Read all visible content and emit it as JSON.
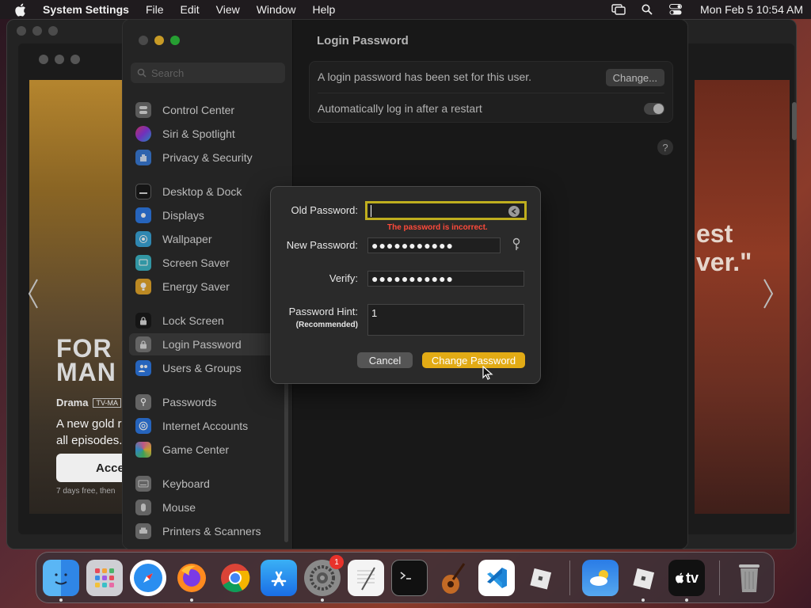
{
  "menubar": {
    "app_name": "System Settings",
    "items": [
      "File",
      "Edit",
      "View",
      "Window",
      "Help"
    ],
    "clock": "Mon Feb 5  10:54 AM"
  },
  "tv": {
    "title": "FOR\nMAN",
    "genre": "Drama",
    "rating": "TV-MA",
    "description": "A new gold ru\nall episodes.",
    "accept": "Accep",
    "fine_print": "7 days free, then",
    "quote": "est\nver.\""
  },
  "sidebar": {
    "search_placeholder": "Search",
    "items": [
      {
        "label": "Control Center",
        "color": "#6e6e6e"
      },
      {
        "label": "Siri & Spotlight",
        "color": "#b03cc8"
      },
      {
        "label": "Privacy & Security",
        "color": "#3a7bd5"
      },
      {
        "label": "Desktop & Dock",
        "color": "#2b2b2b"
      },
      {
        "label": "Displays",
        "color": "#2f7be6"
      },
      {
        "label": "Wallpaper",
        "color": "#3aa5d8"
      },
      {
        "label": "Screen Saver",
        "color": "#3eb8c9"
      },
      {
        "label": "Energy Saver",
        "color": "#e6a82b"
      },
      {
        "label": "Lock Screen",
        "color": "#2b2b2b"
      },
      {
        "label": "Login Password",
        "color": "#7a7a7a"
      },
      {
        "label": "Users & Groups",
        "color": "#2f7be6"
      },
      {
        "label": "Passwords",
        "color": "#7a7a7a"
      },
      {
        "label": "Internet Accounts",
        "color": "#2f7be6"
      },
      {
        "label": "Game Center",
        "color": "#e86aa5"
      },
      {
        "label": "Keyboard",
        "color": "#7a7a7a"
      },
      {
        "label": "Mouse",
        "color": "#7a7a7a"
      },
      {
        "label": "Printers & Scanners",
        "color": "#7a7a7a"
      }
    ]
  },
  "content": {
    "title": "Login Password",
    "row1": "A login password has been set for this user.",
    "change_button": "Change...",
    "row2": "Automatically log in after a restart",
    "help": "?"
  },
  "dialog": {
    "old_label": "Old Password:",
    "old_value": "",
    "error": "The password is incorrect.",
    "new_label": "New Password:",
    "new_value": "●●●●●●●●●●●",
    "verify_label": "Verify:",
    "verify_value": "●●●●●●●●●●●",
    "hint_label": "Password Hint:",
    "hint_sublabel": "(Recommended)",
    "hint_value": "1",
    "cancel": "Cancel",
    "submit": "Change Password"
  },
  "dock": {
    "items": [
      "finder-icon",
      "launchpad-icon",
      "safari-icon",
      "firefox-icon",
      "chrome-icon",
      "app-store-icon",
      "system-settings-icon",
      "textedit-icon",
      "terminal-icon",
      "garageband-icon",
      "vscode-icon",
      "roblox-icon",
      "weather-icon",
      "roblox-studio-icon",
      "apple-tv-icon",
      "trash-icon"
    ],
    "badge": "1",
    "tv_label": "tv"
  },
  "colors": {
    "accent": "#e2ab15",
    "error": "#ff4a3a",
    "focus_ring": "#bfae1e"
  }
}
